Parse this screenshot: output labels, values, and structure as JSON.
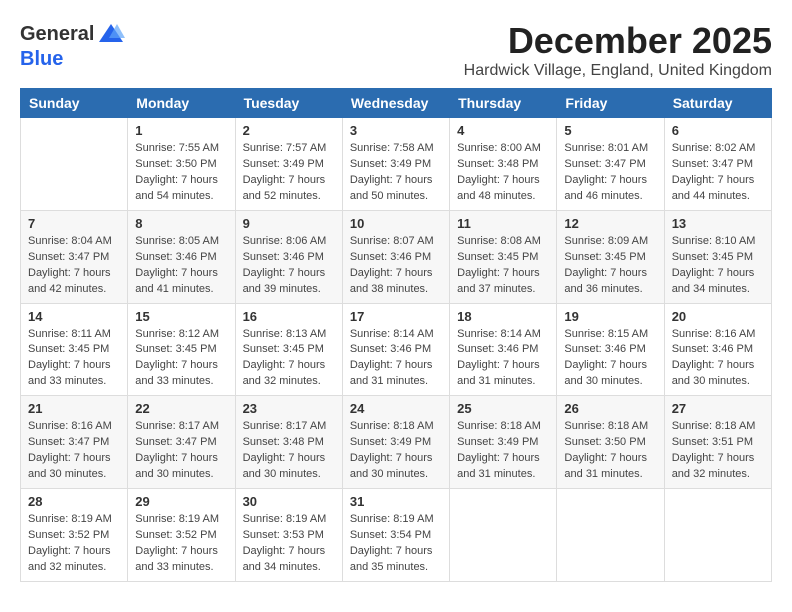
{
  "logo": {
    "general": "General",
    "blue": "Blue"
  },
  "title": "December 2025",
  "location": "Hardwick Village, England, United Kingdom",
  "days_header": [
    "Sunday",
    "Monday",
    "Tuesday",
    "Wednesday",
    "Thursday",
    "Friday",
    "Saturday"
  ],
  "weeks": [
    [
      {
        "day": "",
        "info": ""
      },
      {
        "day": "1",
        "info": "Sunrise: 7:55 AM\nSunset: 3:50 PM\nDaylight: 7 hours\nand 54 minutes."
      },
      {
        "day": "2",
        "info": "Sunrise: 7:57 AM\nSunset: 3:49 PM\nDaylight: 7 hours\nand 52 minutes."
      },
      {
        "day": "3",
        "info": "Sunrise: 7:58 AM\nSunset: 3:49 PM\nDaylight: 7 hours\nand 50 minutes."
      },
      {
        "day": "4",
        "info": "Sunrise: 8:00 AM\nSunset: 3:48 PM\nDaylight: 7 hours\nand 48 minutes."
      },
      {
        "day": "5",
        "info": "Sunrise: 8:01 AM\nSunset: 3:47 PM\nDaylight: 7 hours\nand 46 minutes."
      },
      {
        "day": "6",
        "info": "Sunrise: 8:02 AM\nSunset: 3:47 PM\nDaylight: 7 hours\nand 44 minutes."
      }
    ],
    [
      {
        "day": "7",
        "info": "Sunrise: 8:04 AM\nSunset: 3:47 PM\nDaylight: 7 hours\nand 42 minutes."
      },
      {
        "day": "8",
        "info": "Sunrise: 8:05 AM\nSunset: 3:46 PM\nDaylight: 7 hours\nand 41 minutes."
      },
      {
        "day": "9",
        "info": "Sunrise: 8:06 AM\nSunset: 3:46 PM\nDaylight: 7 hours\nand 39 minutes."
      },
      {
        "day": "10",
        "info": "Sunrise: 8:07 AM\nSunset: 3:46 PM\nDaylight: 7 hours\nand 38 minutes."
      },
      {
        "day": "11",
        "info": "Sunrise: 8:08 AM\nSunset: 3:45 PM\nDaylight: 7 hours\nand 37 minutes."
      },
      {
        "day": "12",
        "info": "Sunrise: 8:09 AM\nSunset: 3:45 PM\nDaylight: 7 hours\nand 36 minutes."
      },
      {
        "day": "13",
        "info": "Sunrise: 8:10 AM\nSunset: 3:45 PM\nDaylight: 7 hours\nand 34 minutes."
      }
    ],
    [
      {
        "day": "14",
        "info": "Sunrise: 8:11 AM\nSunset: 3:45 PM\nDaylight: 7 hours\nand 33 minutes."
      },
      {
        "day": "15",
        "info": "Sunrise: 8:12 AM\nSunset: 3:45 PM\nDaylight: 7 hours\nand 33 minutes."
      },
      {
        "day": "16",
        "info": "Sunrise: 8:13 AM\nSunset: 3:45 PM\nDaylight: 7 hours\nand 32 minutes."
      },
      {
        "day": "17",
        "info": "Sunrise: 8:14 AM\nSunset: 3:46 PM\nDaylight: 7 hours\nand 31 minutes."
      },
      {
        "day": "18",
        "info": "Sunrise: 8:14 AM\nSunset: 3:46 PM\nDaylight: 7 hours\nand 31 minutes."
      },
      {
        "day": "19",
        "info": "Sunrise: 8:15 AM\nSunset: 3:46 PM\nDaylight: 7 hours\nand 30 minutes."
      },
      {
        "day": "20",
        "info": "Sunrise: 8:16 AM\nSunset: 3:46 PM\nDaylight: 7 hours\nand 30 minutes."
      }
    ],
    [
      {
        "day": "21",
        "info": "Sunrise: 8:16 AM\nSunset: 3:47 PM\nDaylight: 7 hours\nand 30 minutes."
      },
      {
        "day": "22",
        "info": "Sunrise: 8:17 AM\nSunset: 3:47 PM\nDaylight: 7 hours\nand 30 minutes."
      },
      {
        "day": "23",
        "info": "Sunrise: 8:17 AM\nSunset: 3:48 PM\nDaylight: 7 hours\nand 30 minutes."
      },
      {
        "day": "24",
        "info": "Sunrise: 8:18 AM\nSunset: 3:49 PM\nDaylight: 7 hours\nand 30 minutes."
      },
      {
        "day": "25",
        "info": "Sunrise: 8:18 AM\nSunset: 3:49 PM\nDaylight: 7 hours\nand 31 minutes."
      },
      {
        "day": "26",
        "info": "Sunrise: 8:18 AM\nSunset: 3:50 PM\nDaylight: 7 hours\nand 31 minutes."
      },
      {
        "day": "27",
        "info": "Sunrise: 8:18 AM\nSunset: 3:51 PM\nDaylight: 7 hours\nand 32 minutes."
      }
    ],
    [
      {
        "day": "28",
        "info": "Sunrise: 8:19 AM\nSunset: 3:52 PM\nDaylight: 7 hours\nand 32 minutes."
      },
      {
        "day": "29",
        "info": "Sunrise: 8:19 AM\nSunset: 3:52 PM\nDaylight: 7 hours\nand 33 minutes."
      },
      {
        "day": "30",
        "info": "Sunrise: 8:19 AM\nSunset: 3:53 PM\nDaylight: 7 hours\nand 34 minutes."
      },
      {
        "day": "31",
        "info": "Sunrise: 8:19 AM\nSunset: 3:54 PM\nDaylight: 7 hours\nand 35 minutes."
      },
      {
        "day": "",
        "info": ""
      },
      {
        "day": "",
        "info": ""
      },
      {
        "day": "",
        "info": ""
      }
    ]
  ]
}
